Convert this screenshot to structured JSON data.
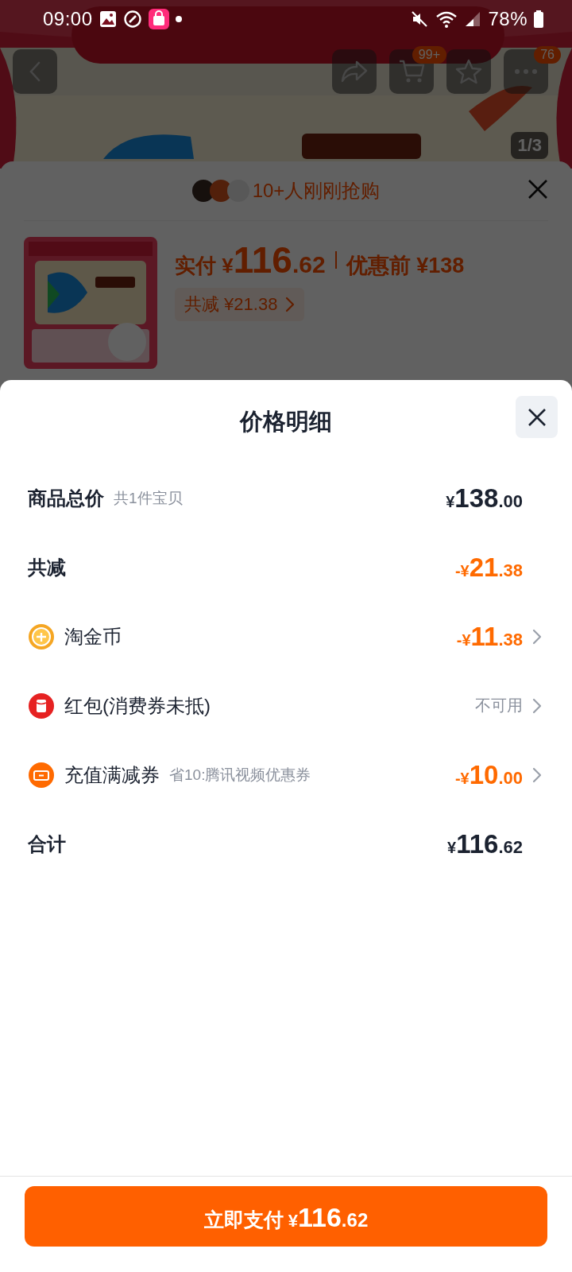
{
  "status_bar": {
    "time": "09:00",
    "battery": "78%"
  },
  "product_page": {
    "cart_badge": "99+",
    "more_badge": "76",
    "image_counter": "1/3"
  },
  "purchase_sheet": {
    "buyers_text": "10+人刚刚抢购",
    "paid_label": "实付",
    "paid_price": {
      "symbol": "¥",
      "integer": "116",
      "decimal": ".62"
    },
    "original_text": "优惠前 ¥138",
    "discount_chip": "共减 ¥21.38"
  },
  "price_detail": {
    "title": "价格明细",
    "rows": [
      {
        "kind": "total",
        "label": "商品总价",
        "note": "共1件宝贝",
        "amount": {
          "symbol": "¥",
          "integer": "138",
          "decimal": ".00"
        },
        "chevron": false
      },
      {
        "kind": "discount",
        "label": "共减",
        "amount": {
          "sign": "-",
          "symbol": "¥",
          "integer": "21",
          "decimal": ".38"
        },
        "chevron": false
      },
      {
        "kind": "coin",
        "label": "淘金币",
        "amount": {
          "sign": "-",
          "symbol": "¥",
          "integer": "11",
          "decimal": ".38"
        },
        "chevron": true
      },
      {
        "kind": "envelope",
        "label": "红包(消费券未抵)",
        "status": "不可用",
        "chevron": true
      },
      {
        "kind": "voucher",
        "label": "充值满减券",
        "note": "省10:腾讯视频优惠券",
        "amount": {
          "sign": "-",
          "symbol": "¥",
          "integer": "10",
          "decimal": ".00"
        },
        "chevron": true
      },
      {
        "kind": "total",
        "label": "合计",
        "amount": {
          "symbol": "¥",
          "integer": "116",
          "decimal": ".62"
        },
        "chevron": false
      }
    ]
  },
  "pay_button": {
    "label": "立即支付",
    "price": {
      "symbol": "¥",
      "integer": "116",
      "decimal": ".62"
    }
  }
}
